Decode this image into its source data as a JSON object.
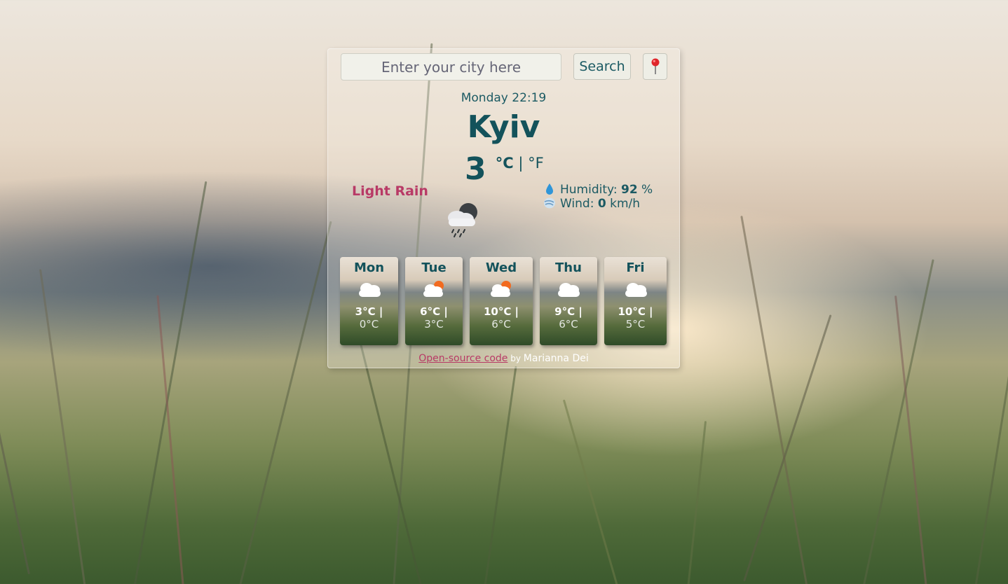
{
  "search": {
    "placeholder": "Enter your city here",
    "button_label": "Search",
    "location_icon": "pin-icon"
  },
  "current": {
    "datetime": "Monday 22:19",
    "city": "Kyiv",
    "temperature": "3",
    "unit_c": "°C",
    "unit_sep": " | ",
    "unit_f": "°F",
    "description": "Light Rain",
    "icon": "night-cloud-rain-icon",
    "humidity_label": "Humidity: ",
    "humidity_value": "92",
    "humidity_unit": " %",
    "wind_label": "Wind: ",
    "wind_value": "0",
    "wind_unit": " km/h"
  },
  "forecast": [
    {
      "day": "Mon",
      "max": "3°C |",
      "min": "0°C",
      "icon": "cloud-icon"
    },
    {
      "day": "Tue",
      "max": "6°C |",
      "min": "3°C",
      "icon": "sun-cloud-icon"
    },
    {
      "day": "Wed",
      "max": "10°C |",
      "min": "6°C",
      "icon": "sun-cloud-icon"
    },
    {
      "day": "Thu",
      "max": "9°C |",
      "min": "6°C",
      "icon": "cloud-icon"
    },
    {
      "day": "Fri",
      "max": "10°C |",
      "min": "5°C",
      "icon": "cloud-icon"
    }
  ],
  "footer": {
    "link_text": "Open-source code",
    "by_text": " by ",
    "author": "Marianna Dei"
  },
  "colors": {
    "accent": "#13525b",
    "highlight": "#b83a66"
  }
}
